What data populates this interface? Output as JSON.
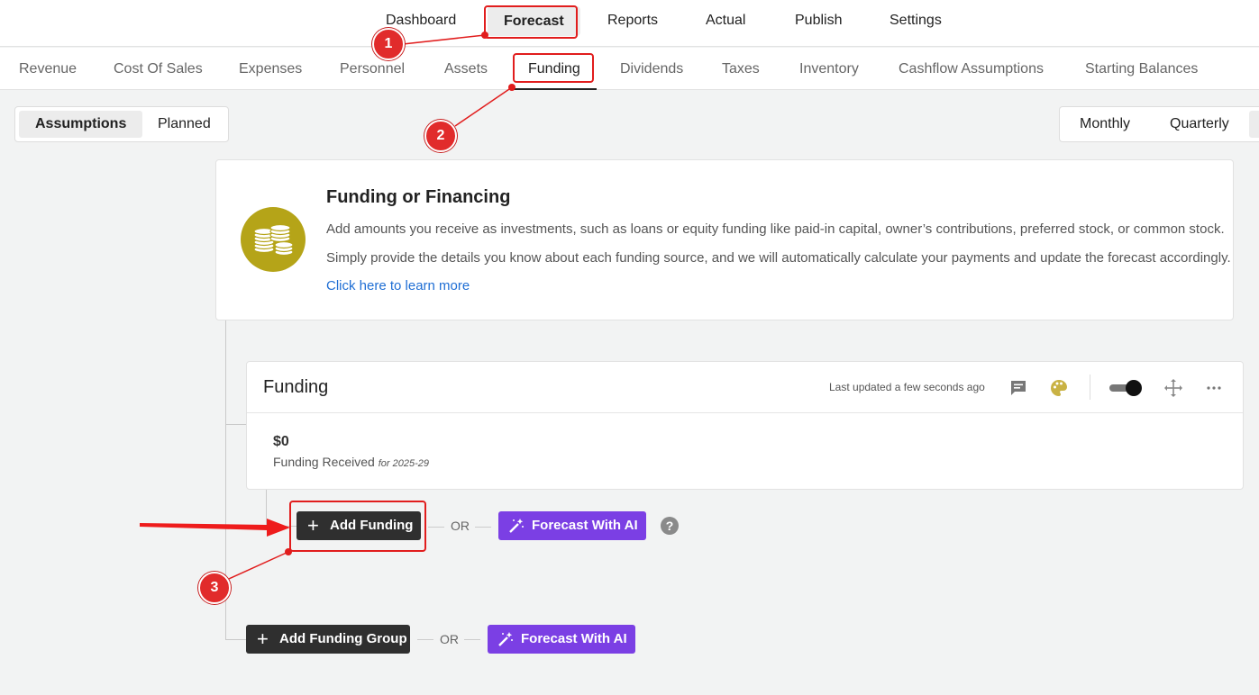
{
  "top_nav": {
    "items": [
      "Dashboard",
      "Forecast",
      "Reports",
      "Actual",
      "Publish",
      "Settings"
    ],
    "active": "Forecast"
  },
  "sub_nav": {
    "items": [
      "Revenue",
      "Cost Of Sales",
      "Expenses",
      "Personnel",
      "Assets",
      "Funding",
      "Dividends",
      "Taxes",
      "Inventory",
      "Cashflow Assumptions",
      "Starting Balances"
    ],
    "active": "Funding"
  },
  "view_toggle": {
    "options": [
      "Assumptions",
      "Planned"
    ],
    "active": "Assumptions"
  },
  "period_toggle": {
    "options": [
      "Monthly",
      "Quarterly"
    ]
  },
  "info_card": {
    "icon": "coins-icon",
    "title": "Funding or Financing",
    "line1": "Add amounts you receive as investments, such as loans or equity funding like paid-in capital, owner’s contributions, preferred stock, or common stock.",
    "line2": "Simply provide the details you know about each funding source, and we will automatically calculate your payments and update the forecast accordingly.",
    "link": "Click here to learn more"
  },
  "funding_card": {
    "title": "Funding",
    "last_updated": "Last updated a few seconds ago",
    "icons": [
      "comment-icon",
      "palette-icon",
      "toggle-switch",
      "move-icon",
      "more-icon"
    ],
    "amount": "$0",
    "amount_label": "Funding Received",
    "period": "for 2025-29"
  },
  "actions": {
    "add_funding": "Add Funding",
    "or": "OR",
    "forecast_ai": "Forecast With AI",
    "add_group": "Add Funding Group",
    "help": "?"
  },
  "annotations": {
    "steps": [
      "1",
      "2",
      "3"
    ],
    "color": "#e11d1d"
  },
  "colors": {
    "accent_ai": "#7b3fe4",
    "dark_button": "#2f2f2f",
    "coin": "#b5a418",
    "link": "#1f6ed4"
  }
}
